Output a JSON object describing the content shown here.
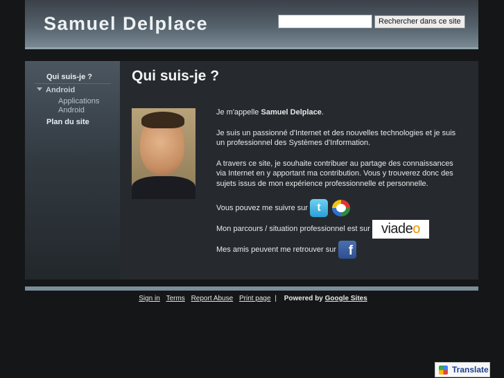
{
  "header": {
    "site_title": "Samuel Delplace",
    "search_value": "",
    "search_button": "Rechercher dans ce site"
  },
  "sidebar": {
    "items": [
      {
        "label": "Qui suis-je ?"
      },
      {
        "label": "Android"
      },
      {
        "label": "Applications Android"
      },
      {
        "label": "Plan du site"
      }
    ]
  },
  "main": {
    "title": "Qui suis-je ?",
    "intro_prefix": "Je m'appelle ",
    "intro_name": "Samuel Delplace",
    "intro_suffix": ".",
    "paragraph_2": "Je suis un passionné d'Internet et des nouvelles technologies et je suis un professionnel des Systèmes d'Information.",
    "paragraph_3": "A travers ce site, je souhaite contribuer au partage des connaissances via Internet en y apportant ma contribution. Vous y trouverez donc des sujets issus de mon expérience professionnelle et personnelle.",
    "follow_text": "Vous pouvez me suivre sur",
    "career_text": "Mon parcours / situation professionnel est sur",
    "friends_text": "Mes amis peuvent me retrouver sur",
    "viadeo_text": "viade",
    "viadeo_o": "o"
  },
  "icons": {
    "twitter": "twitter-icon",
    "buzz": "google-buzz-icon",
    "viadeo": "viadeo-logo",
    "facebook": "facebook-icon"
  },
  "footer": {
    "links": [
      "Sign in",
      "Terms",
      "Report Abuse",
      "Print page"
    ],
    "separator": "|",
    "powered_prefix": "Powered by",
    "powered_link": "Google Sites"
  },
  "translate": {
    "label": "Translate"
  }
}
